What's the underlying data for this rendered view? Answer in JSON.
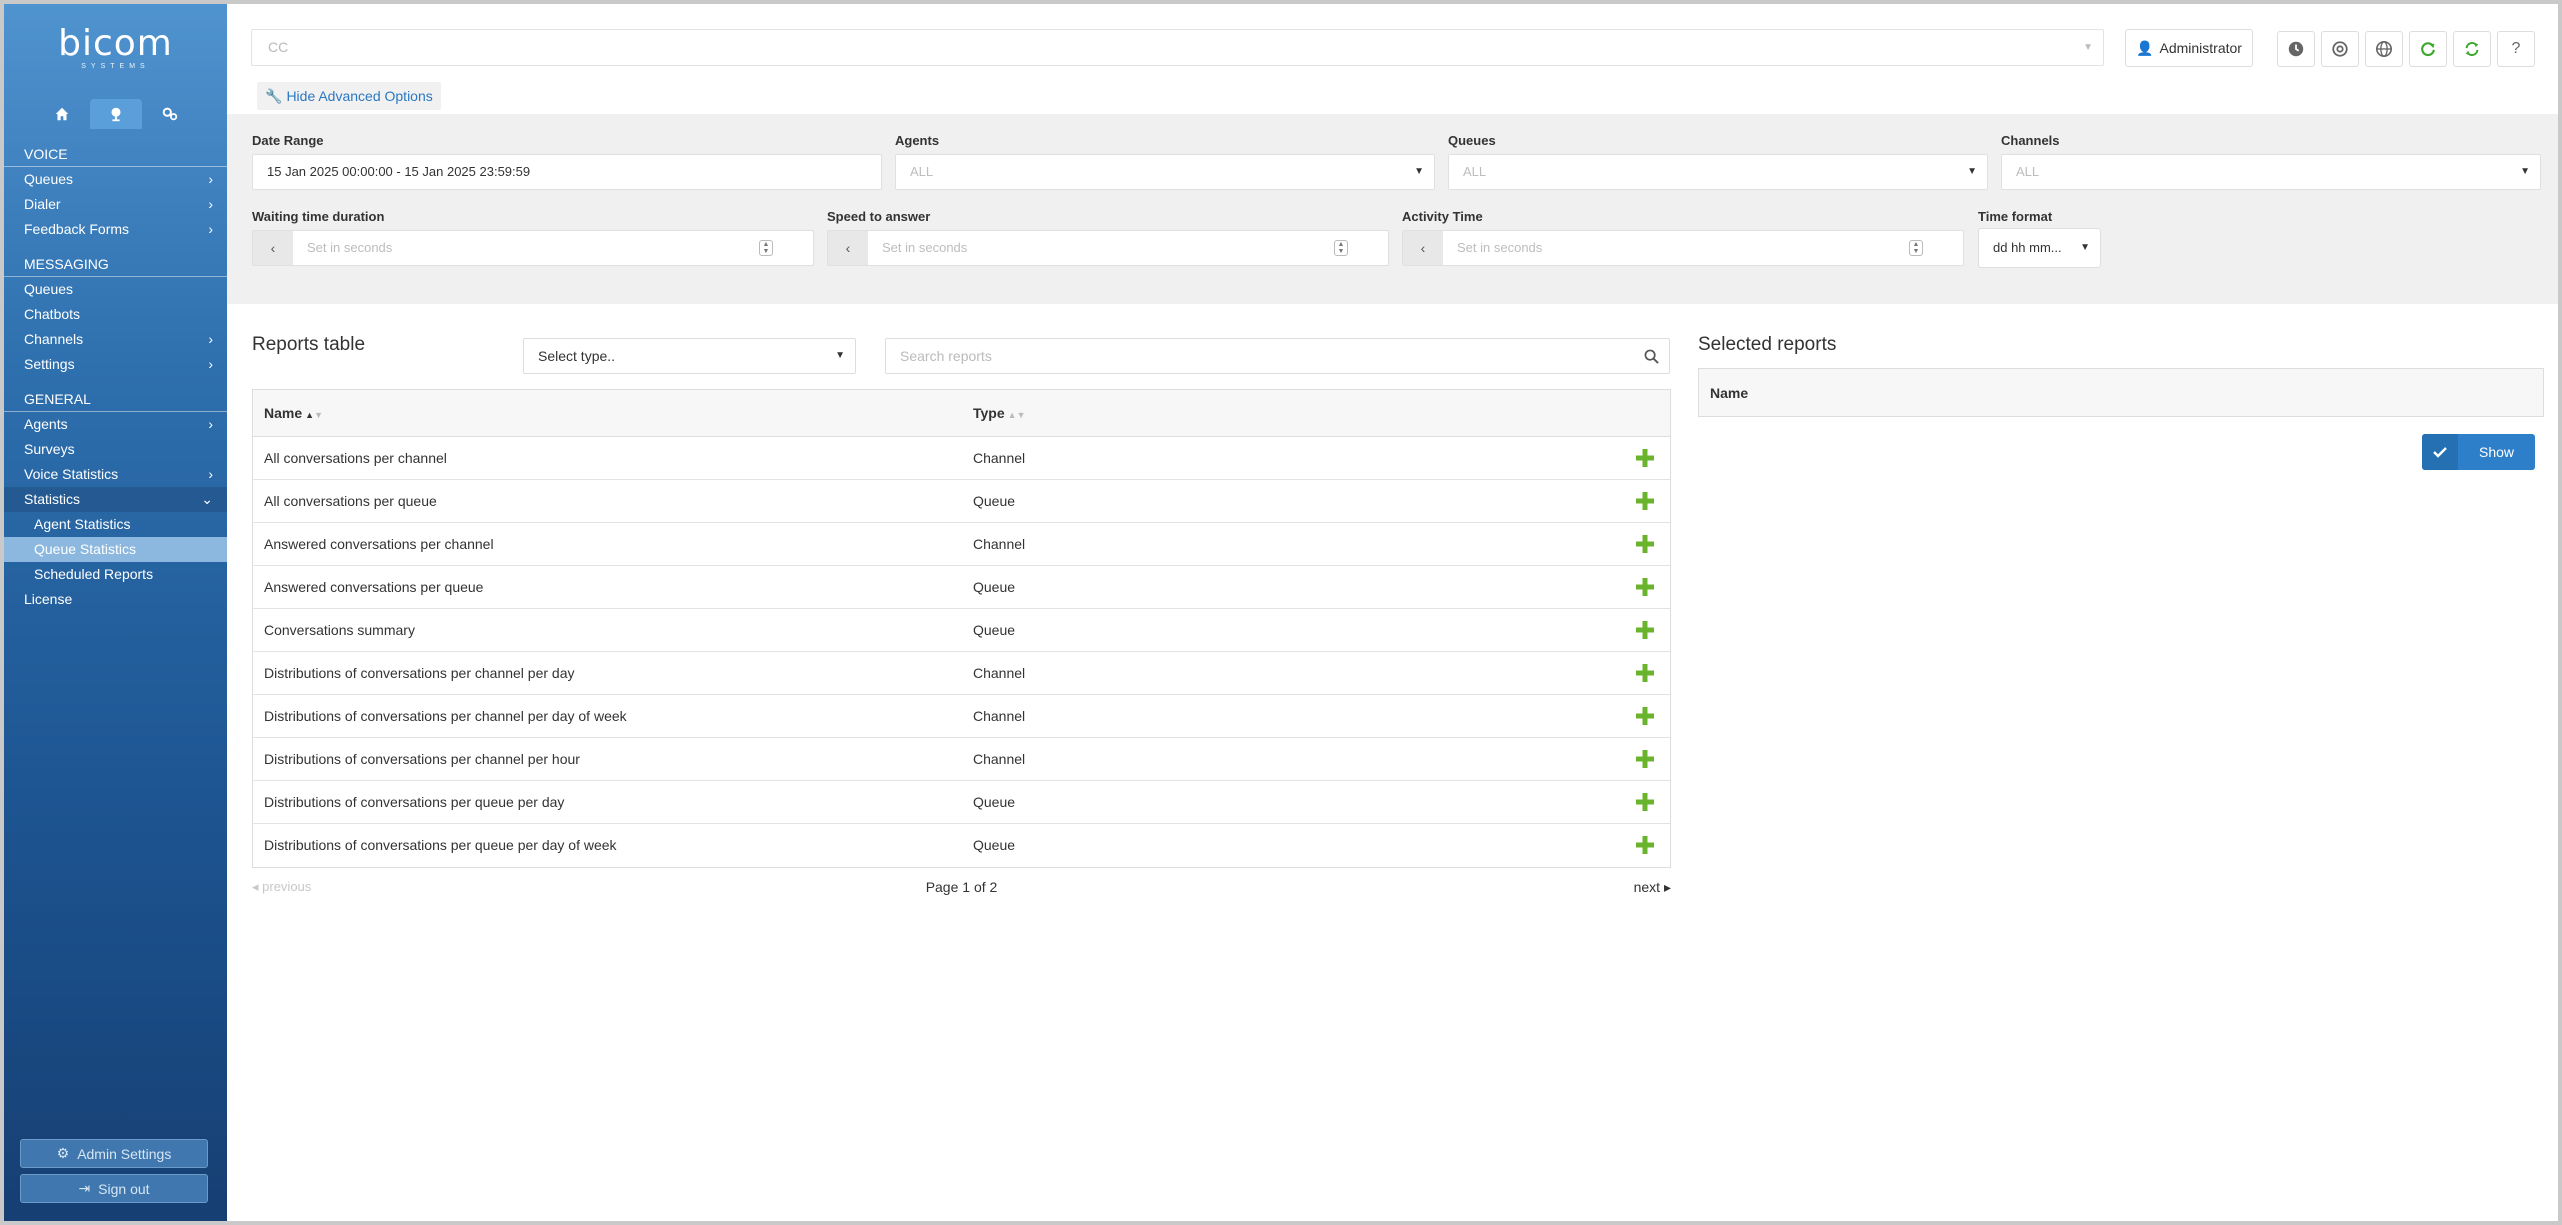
{
  "brand": {
    "name": "bicom",
    "tagline": "SYSTEMS"
  },
  "sidebar": {
    "tabs": [
      {
        "icon": "home-icon"
      },
      {
        "icon": "cloud-icon"
      },
      {
        "icon": "gears-icon"
      }
    ],
    "sections": [
      {
        "title": "VOICE",
        "items": [
          {
            "label": "Queues",
            "chevron": true
          },
          {
            "label": "Dialer",
            "chevron": true
          },
          {
            "label": "Feedback Forms",
            "chevron": true
          }
        ]
      },
      {
        "title": "MESSAGING",
        "items": [
          {
            "label": "Queues",
            "chevron": false
          },
          {
            "label": "Chatbots",
            "chevron": false
          },
          {
            "label": "Channels",
            "chevron": true
          },
          {
            "label": "Settings",
            "chevron": true
          }
        ]
      },
      {
        "title": "GENERAL",
        "items": [
          {
            "label": "Agents",
            "chevron": true
          },
          {
            "label": "Surveys",
            "chevron": false
          },
          {
            "label": "Voice Statistics",
            "chevron": true
          },
          {
            "label": "Statistics",
            "chevron": true,
            "open": true,
            "children": [
              {
                "label": "Agent Statistics",
                "active": false
              },
              {
                "label": "Queue Statistics",
                "active": true
              },
              {
                "label": "Scheduled Reports",
                "active": false
              }
            ]
          },
          {
            "label": "License",
            "chevron": false
          }
        ]
      }
    ],
    "admin_settings": "Admin Settings",
    "sign_out": "Sign out"
  },
  "topbar": {
    "tenant_value": "CC",
    "user_label": "Administrator",
    "hide_advanced": "Hide Advanced Options"
  },
  "filters": {
    "date_range": {
      "label": "Date Range",
      "value": "15 Jan 2025 00:00:00 - 15 Jan 2025 23:59:59"
    },
    "agents": {
      "label": "Agents",
      "value": "ALL"
    },
    "queues": {
      "label": "Queues",
      "value": "ALL"
    },
    "channels": {
      "label": "Channels",
      "value": "ALL"
    },
    "waiting_time": {
      "label": "Waiting time duration",
      "placeholder": "Set in seconds"
    },
    "speed_to_answer": {
      "label": "Speed to answer",
      "placeholder": "Set in seconds"
    },
    "activity_time": {
      "label": "Activity Time",
      "placeholder": "Set in seconds"
    },
    "time_format": {
      "label": "Time format",
      "value": "dd hh mm..."
    }
  },
  "reports": {
    "title": "Reports table",
    "type_select": "Select type..",
    "search_placeholder": "Search reports",
    "columns": {
      "name": "Name",
      "type": "Type"
    },
    "rows": [
      {
        "name": "All conversations per channel",
        "type": "Channel"
      },
      {
        "name": "All conversations per queue",
        "type": "Queue"
      },
      {
        "name": "Answered conversations per channel",
        "type": "Channel"
      },
      {
        "name": "Answered conversations per queue",
        "type": "Queue"
      },
      {
        "name": "Conversations summary",
        "type": "Queue"
      },
      {
        "name": "Distributions of conversations per channel per day",
        "type": "Channel"
      },
      {
        "name": "Distributions of conversations per channel per day of week",
        "type": "Channel"
      },
      {
        "name": "Distributions of conversations per channel per hour",
        "type": "Channel"
      },
      {
        "name": "Distributions of conversations per queue per day",
        "type": "Queue"
      },
      {
        "name": "Distributions of conversations per queue per day of week",
        "type": "Queue"
      }
    ],
    "pager": {
      "previous": "previous",
      "info": "Page 1 of 2",
      "next": "next"
    }
  },
  "selected": {
    "title": "Selected reports",
    "column": "Name",
    "show_label": "Show"
  },
  "colors": {
    "accent": "#2c7fc8",
    "add": "#6ab42d",
    "refresh": "#3aa82a"
  }
}
